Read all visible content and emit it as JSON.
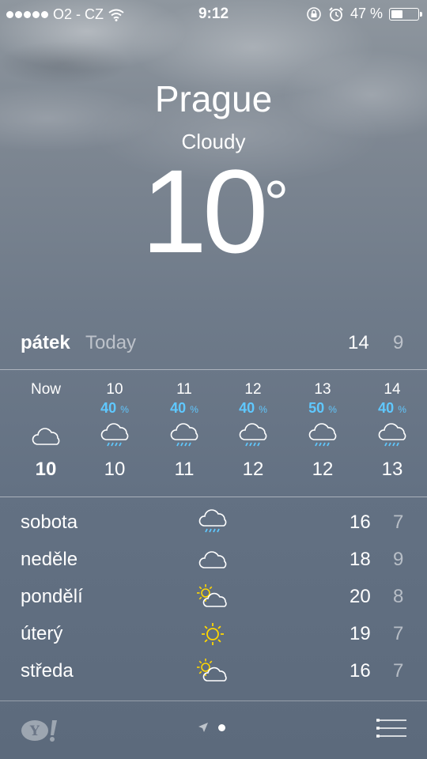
{
  "status_bar": {
    "carrier": "O2 - CZ",
    "signal_dots": 5,
    "time": "9:12",
    "battery_text": "47 %",
    "battery_level": 0.47
  },
  "location": {
    "city": "Prague",
    "condition": "Cloudy",
    "temperature": "10",
    "degree_symbol": "°"
  },
  "today": {
    "day": "pátek",
    "label": "Today",
    "high": "14",
    "low": "9"
  },
  "hourly": [
    {
      "time": "Now",
      "precip": "",
      "icon": "cloud-icon",
      "temp": "10"
    },
    {
      "time": "10",
      "precip": "40",
      "icon": "rain-cloud-icon",
      "temp": "10"
    },
    {
      "time": "11",
      "precip": "40",
      "icon": "rain-cloud-icon",
      "temp": "11"
    },
    {
      "time": "12",
      "precip": "40",
      "icon": "rain-cloud-icon",
      "temp": "12"
    },
    {
      "time": "13",
      "precip": "50",
      "icon": "rain-cloud-icon",
      "temp": "12"
    },
    {
      "time": "14",
      "precip": "40",
      "icon": "rain-cloud-icon",
      "temp": "13"
    }
  ],
  "precip_unit": "%",
  "daily": [
    {
      "day": "sobota",
      "icon": "rain-cloud-icon",
      "high": "16",
      "low": "7"
    },
    {
      "day": "neděle",
      "icon": "cloud-icon",
      "high": "18",
      "low": "9"
    },
    {
      "day": "pondělí",
      "icon": "partly-sunny-icon",
      "high": "20",
      "low": "8"
    },
    {
      "day": "úterý",
      "icon": "sun-icon",
      "high": "19",
      "low": "7"
    },
    {
      "day": "středa",
      "icon": "partly-sunny-icon",
      "high": "16",
      "low": "7"
    }
  ],
  "colors": {
    "precip": "#5fc8ff",
    "sun": "#ffd700"
  },
  "footer": {
    "brand_icon": "yahoo-logo-icon",
    "location_icon": "location-arrow-icon",
    "menu_icon": "list-icon"
  }
}
